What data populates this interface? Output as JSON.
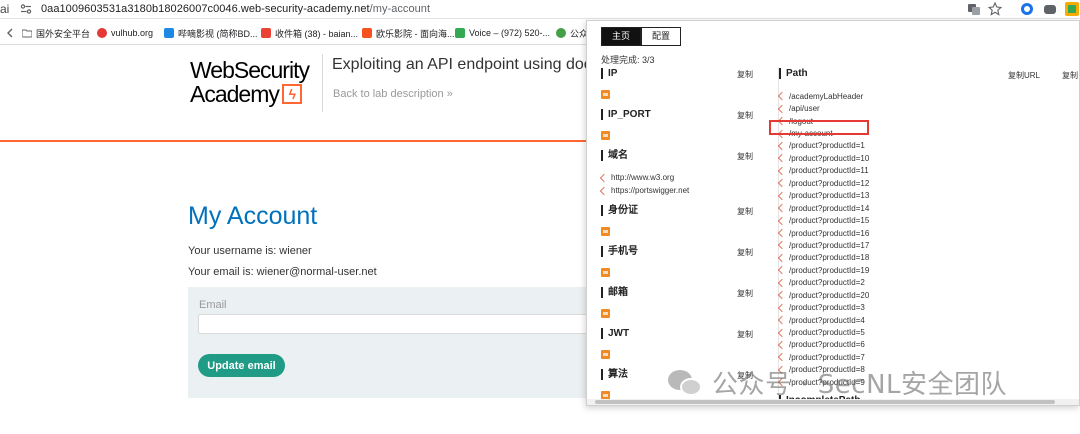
{
  "browser": {
    "address_lead": "ai",
    "url_host": "0aa1009603531a3180b18026007c0046.web-security-academy.net",
    "url_path": "/my-account",
    "bookmarks": [
      {
        "label": "国外安全平台",
        "color": "#5f6368"
      },
      {
        "label": "vulhub.org",
        "color": "#e53935"
      },
      {
        "label": "哔嘀影视 (简称BD...",
        "color": "#1e88e5"
      },
      {
        "label": "收件箱 (38) - baian...",
        "color": "#ea4335"
      },
      {
        "label": "欧乐影院 - 面向海...",
        "color": "#f4511e"
      },
      {
        "label": "Voice – (972) 520-...",
        "color": "#34a853"
      },
      {
        "label": "公众",
        "color": "#43a047"
      }
    ]
  },
  "header": {
    "logo_line1": "WebSecurity",
    "logo_line2": "Academy",
    "logo_mark": "ϟ",
    "lab_title": "Exploiting an API endpoint using doc",
    "back_link": "Back to lab description  »"
  },
  "account": {
    "title": "My Account",
    "username_line": "Your username is: wiener",
    "email_line": "Your email is: wiener@normal-user.net",
    "email_label": "Email",
    "email_value": "",
    "update_button": "Update email"
  },
  "extension": {
    "tabs": [
      "主页",
      "配置"
    ],
    "progress": "处理完成: 3/3",
    "copy_label": "复制",
    "sections": [
      {
        "title": "IP",
        "has_badge": true
      },
      {
        "title": "IP_PORT",
        "has_badge": true
      },
      {
        "title": "域名",
        "has_badge": false
      },
      {
        "title": "身份证",
        "has_badge": true
      },
      {
        "title": "手机号",
        "has_badge": true
      },
      {
        "title": "邮箱",
        "has_badge": true
      },
      {
        "title": "JWT",
        "has_badge": true
      },
      {
        "title": "算法",
        "has_badge": true
      }
    ],
    "domains": [
      "http://www.w3.org",
      "https://portswigger.net"
    ],
    "path_title": "Path",
    "copy_url": "复制URL",
    "copy_right": "复制",
    "paths": [
      "/academyLabHeader",
      "/api/user",
      "/logout",
      "/my-account",
      "/product?productId=1",
      "/product?productId=10",
      "/product?productId=11",
      "/product?productId=12",
      "/product?productId=13",
      "/product?productId=14",
      "/product?productId=15",
      "/product?productId=16",
      "/product?productId=17",
      "/product?productId=18",
      "/product?productId=19",
      "/product?productId=2",
      "/product?productId=20",
      "/product?productId=3",
      "/product?productId=4",
      "/product?productId=5",
      "/product?productId=6",
      "/product?productId=7",
      "/product?productId=8",
      "/product?productId=9"
    ],
    "incomplete_title": "IncompletePath"
  },
  "watermark": {
    "text": "公众号 · SecNL安全团队"
  },
  "colors": {
    "accent_orange": "#ff6633",
    "title_blue": "#0071bc",
    "button_green": "#1f9b86",
    "highlight_red": "#e53935"
  }
}
